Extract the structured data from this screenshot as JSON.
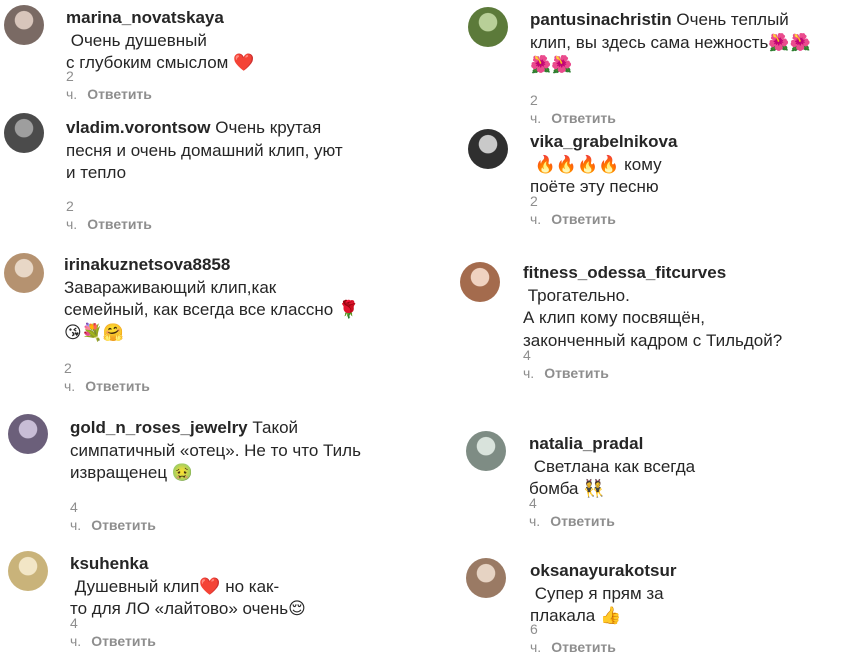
{
  "reply_label": "Ответить",
  "comments": [
    {
      "user": "marina_novatskaya",
      "text": "Очень душевный\nс глубоким смыслом ❤️",
      "time": "2 ч."
    },
    {
      "user": "vladim.vorontsow",
      "text": "Очень крутая\nпесня и очень домашний клип, уют\nи тепло",
      "time": "2 ч."
    },
    {
      "user": "irinakuznetsova8858",
      "text": "\nЗавараживающий клип,как\nсемейный, как всегда все классно 🌹\n😘💐🤗",
      "time": "2 ч."
    },
    {
      "user": "gold_n_roses_jewelry",
      "text": "Такой\nсимпатичный «отец». Не то что Тиль\nизвращенец 🤢",
      "time": "4 ч."
    },
    {
      "user": "ksuhenka",
      "text": "Душевный клип❤️ но как-\nто для ЛО «лайтово» очень😌",
      "time": "4 ч."
    },
    {
      "user": "pantusinachristin",
      "text": "Очень теплый\nклип, вы здесь сама нежность🌺🌺\n🌺🌺",
      "time": "2 ч."
    },
    {
      "user": "vika_grabelnikova",
      "text": "🔥🔥🔥🔥 кому\nпоёте эту песню",
      "time": "2 ч."
    },
    {
      "user": "fitness_odessa_fitcurves",
      "text": "Трогательно.\nА клип кому посвящён,\nзаконченный кадром с Тильдой?",
      "time": "4 ч."
    },
    {
      "user": "natalia_pradal",
      "text": "Светлана как всегда\nбомба 👯",
      "time": "4 ч."
    },
    {
      "user": "oksanayurakotsur",
      "text": "Супер я прям за\nплакала 👍",
      "time": "6 ч."
    }
  ]
}
